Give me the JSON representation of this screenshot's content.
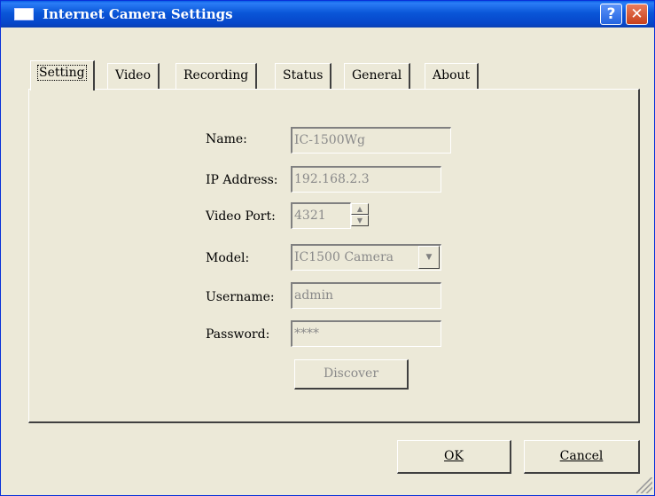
{
  "window": {
    "title": "Internet Camera Settings",
    "help_label": "?",
    "close_label": "✕"
  },
  "tabs": [
    {
      "label": "Setting",
      "active": true
    },
    {
      "label": "Video",
      "active": false
    },
    {
      "label": "Recording",
      "active": false
    },
    {
      "label": "Status",
      "active": false
    },
    {
      "label": "General",
      "active": false
    },
    {
      "label": "About",
      "active": false
    }
  ],
  "form": {
    "name": {
      "label": "Name:",
      "value": "IC-1500Wg"
    },
    "ip": {
      "label": "IP Address:",
      "value": "192.168.2.3"
    },
    "port": {
      "label": "Video Port:",
      "value": "4321"
    },
    "model": {
      "label": "Model:",
      "value": "IC1500 Camera"
    },
    "username": {
      "label": "Username:",
      "value": "admin"
    },
    "password": {
      "label": "Password:",
      "value": "****"
    },
    "discover_label": "Discover"
  },
  "footer": {
    "ok_label": "OK",
    "cancel_label": "Cancel"
  },
  "colors": {
    "titlebar": "#0a56d8",
    "face": "#ece9d8",
    "disabled_text": "#8a8a8a"
  }
}
